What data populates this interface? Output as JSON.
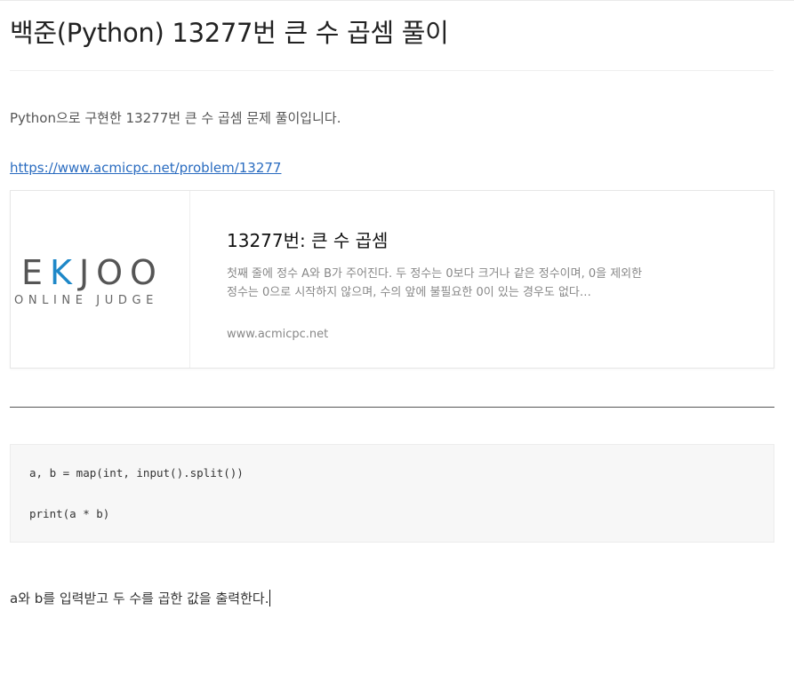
{
  "post": {
    "title": "백준(Python) 13277번 큰 수 곱셈 풀이",
    "intro": "Python으로 구현한 13277번 큰 수 곱셈 문제 풀이입니다.",
    "link_text": "https://www.acmicpc.net/problem/13277",
    "outro": "a와 b를 입력받고 두 수를 곱한 값을 출력한다."
  },
  "og_card": {
    "logo_main_left": "E",
    "logo_main_accent": "K",
    "logo_main_right": "JOO",
    "logo_sub": "ONLINE JUDGE",
    "title": "13277번: 큰 수 곱셈",
    "description": "첫째 줄에 정수 A와 B가 주어진다. 두 정수는 0보다 크거나 같은 정수이며, 0을 제외한 정수는 0으로 시작하지 않으며, 수의 앞에 불필요한 0이 있는 경우도 없다…",
    "host": "www.acmicpc.net"
  },
  "code": {
    "lines": [
      "a, b = map(int, input().split())",
      "print(a * b)"
    ]
  },
  "colors": {
    "link": "#2a6cc0",
    "logo_accent": "#1e88c8",
    "code_background": "#f7f7f7"
  }
}
